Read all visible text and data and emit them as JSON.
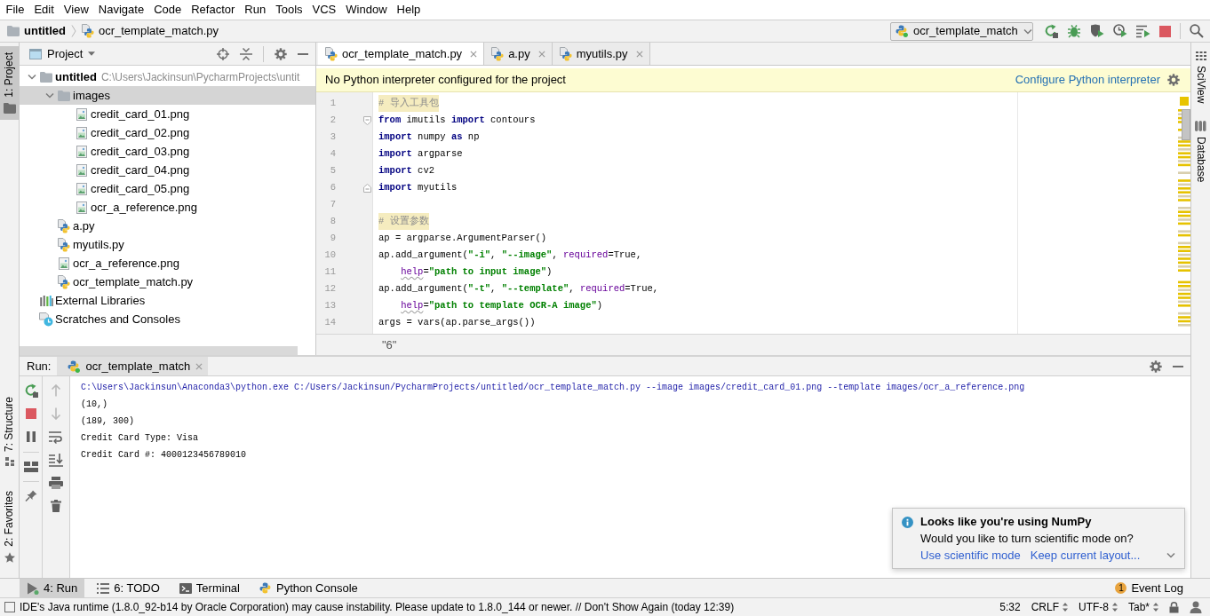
{
  "menu": [
    "File",
    "Edit",
    "View",
    "Navigate",
    "Code",
    "Refactor",
    "Run",
    "Tools",
    "VCS",
    "Window",
    "Help"
  ],
  "navigation_bar": {
    "breadcrumbs": [
      {
        "label": "untitled",
        "kind": "folder"
      },
      {
        "label": "ocr_template_match.py",
        "kind": "python"
      }
    ],
    "run_configuration": "ocr_template_match"
  },
  "left_stripe": [
    {
      "label": "1: Project",
      "kind": "project",
      "selected": true
    },
    {
      "label": "7: Structure",
      "kind": "structure",
      "selected": false
    },
    {
      "label": "2: Favorites",
      "kind": "favorites",
      "selected": false
    }
  ],
  "right_stripe": [
    {
      "label": "SciView",
      "kind": "sciview"
    },
    {
      "label": "Database",
      "kind": "database"
    }
  ],
  "project": {
    "title": "Project",
    "tree": [
      {
        "label": "untitled",
        "path": "C:\\Users\\Jackinsun\\PycharmProjects\\untit",
        "kind": "folder",
        "expanded": true,
        "selected": false,
        "children": [
          {
            "label": "images",
            "kind": "folder",
            "expanded": true,
            "selected": true,
            "children": [
              {
                "label": "credit_card_01.png",
                "kind": "image",
                "selected": false
              },
              {
                "label": "credit_card_02.png",
                "kind": "image",
                "selected": false
              },
              {
                "label": "credit_card_03.png",
                "kind": "image",
                "selected": false
              },
              {
                "label": "credit_card_04.png",
                "kind": "image",
                "selected": false
              },
              {
                "label": "credit_card_05.png",
                "kind": "image",
                "selected": false
              },
              {
                "label": "ocr_a_reference.png",
                "kind": "image",
                "selected": false
              }
            ]
          },
          {
            "label": "a.py",
            "kind": "python",
            "selected": false
          },
          {
            "label": "myutils.py",
            "kind": "python",
            "selected": false
          },
          {
            "label": "ocr_a_reference.png",
            "kind": "image",
            "selected": false
          },
          {
            "label": "ocr_template_match.py",
            "kind": "python",
            "selected": false
          }
        ]
      },
      {
        "label": "External Libraries",
        "kind": "libraries",
        "selected": false
      },
      {
        "label": "Scratches and Consoles",
        "kind": "scratches",
        "selected": false
      }
    ]
  },
  "editor": {
    "tabs": [
      {
        "label": "ocr_template_match.py",
        "selected": true
      },
      {
        "label": "a.py",
        "selected": false
      },
      {
        "label": "myutils.py",
        "selected": false
      }
    ],
    "banner": {
      "message": "No Python interpreter configured for the project",
      "action": "Configure Python interpreter"
    },
    "lines": [
      {
        "number": "1",
        "kind": "code",
        "tokens": [
          {
            "kind": "comment",
            "text": "# 导入工具包"
          }
        ]
      },
      {
        "number": "2",
        "kind": "fold_start",
        "tokens": [
          {
            "kind": "keyword",
            "text": "from"
          },
          {
            "kind": "plain",
            "text": " imutils "
          },
          {
            "kind": "keyword",
            "text": "import"
          },
          {
            "kind": "plain",
            "text": " contours"
          }
        ]
      },
      {
        "number": "3",
        "kind": "code",
        "tokens": [
          {
            "kind": "keyword",
            "text": "import"
          },
          {
            "kind": "plain",
            "text": " numpy "
          },
          {
            "kind": "keyword",
            "text": "as"
          },
          {
            "kind": "plain",
            "text": " np"
          }
        ]
      },
      {
        "number": "4",
        "kind": "code",
        "tokens": [
          {
            "kind": "keyword",
            "text": "import"
          },
          {
            "kind": "plain",
            "text": " argparse"
          }
        ]
      },
      {
        "number": "5",
        "kind": "code",
        "tokens": [
          {
            "kind": "keyword",
            "text": "import"
          },
          {
            "kind": "plain",
            "text": " cv2"
          }
        ]
      },
      {
        "number": "6",
        "kind": "fold_end",
        "tokens": [
          {
            "kind": "keyword",
            "text": "import"
          },
          {
            "kind": "plain",
            "text": " myutils"
          }
        ]
      },
      {
        "number": "7",
        "kind": "blank"
      },
      {
        "number": "8",
        "kind": "code",
        "tokens": [
          {
            "kind": "comment",
            "text": "# 设置参数"
          }
        ]
      },
      {
        "number": "9",
        "kind": "code",
        "tokens": [
          {
            "kind": "plain",
            "text": "ap = argparse.ArgumentParser()"
          }
        ]
      },
      {
        "number": "10",
        "kind": "code",
        "tokens": [
          {
            "kind": "plain",
            "text": "ap.add_argument("
          },
          {
            "kind": "string",
            "text": "\"-i\""
          },
          {
            "kind": "plain",
            "text": ", "
          },
          {
            "kind": "string",
            "text": "\"--image\""
          },
          {
            "kind": "plain",
            "text": ", "
          },
          {
            "kind": "param",
            "text": "required"
          },
          {
            "kind": "plain",
            "text": "=True,"
          }
        ]
      },
      {
        "number": "11",
        "kind": "code",
        "indented": true,
        "tokens": [
          {
            "kind": "param",
            "text": "help",
            "typo": true
          },
          {
            "kind": "plain",
            "text": "="
          },
          {
            "kind": "string",
            "text": "\"path to input image\""
          },
          {
            "kind": "plain",
            "text": ")"
          }
        ]
      },
      {
        "number": "12",
        "kind": "code",
        "tokens": [
          {
            "kind": "plain",
            "text": "ap.add_argument("
          },
          {
            "kind": "string",
            "text": "\"-t\""
          },
          {
            "kind": "plain",
            "text": ", "
          },
          {
            "kind": "string",
            "text": "\"--template\""
          },
          {
            "kind": "plain",
            "text": ", "
          },
          {
            "kind": "param",
            "text": "required"
          },
          {
            "kind": "plain",
            "text": "=True,"
          }
        ]
      },
      {
        "number": "13",
        "kind": "code",
        "indented": true,
        "tokens": [
          {
            "kind": "param",
            "text": "help",
            "typo": true
          },
          {
            "kind": "plain",
            "text": "="
          },
          {
            "kind": "string",
            "text": "\"path to template OCR-A image\""
          },
          {
            "kind": "plain",
            "text": ")"
          }
        ]
      },
      {
        "number": "14",
        "kind": "code",
        "tokens": [
          {
            "kind": "plain",
            "text": "args = vars(ap.parse_args())"
          }
        ]
      }
    ],
    "breadcrumb": "\"6\""
  },
  "run": {
    "title": "Run:",
    "tab": {
      "label": "ocr_template_match",
      "selected": true
    },
    "output": [
      {
        "kind": "command",
        "text": "C:\\Users\\Jackinsun\\Anaconda3\\python.exe C:/Users/Jackinsun/PycharmProjects/untitled/ocr_template_match.py --image images/credit_card_01.png --template images/ocr_a_reference.png"
      },
      {
        "kind": "output",
        "text": "(10,)"
      },
      {
        "kind": "output",
        "text": "(189, 300)"
      },
      {
        "kind": "output",
        "text": "Credit Card Type: Visa"
      },
      {
        "kind": "output",
        "text": "Credit Card #: 4000123456789010"
      }
    ]
  },
  "notification": {
    "title": "Looks like you're using NumPy",
    "message": "Would you like to turn scientific mode on?",
    "actions": [
      "Use scientific mode",
      "Keep current layout..."
    ]
  },
  "tool_windows": [
    {
      "label": "4: Run",
      "kind": "run",
      "selected": true
    },
    {
      "label": "6: TODO",
      "kind": "todo",
      "selected": false
    },
    {
      "label": "Terminal",
      "kind": "terminal",
      "selected": false
    },
    {
      "label": "Python Console",
      "kind": "python_console",
      "selected": false
    }
  ],
  "event_log": {
    "label": "Event Log",
    "count": "1"
  },
  "status_bar": {
    "message": "IDE's Java runtime (1.8.0_92-b14 by Oracle Corporation) may cause instability. Please update to 1.8.0_144 or newer. // Don't Show Again (today 12:39)",
    "items": [
      {
        "label": "5:32",
        "kind": "position"
      },
      {
        "label": "CRLF",
        "kind": "line_separator"
      },
      {
        "label": "UTF-8",
        "kind": "encoding"
      },
      {
        "label": "Tab*",
        "kind": "indent"
      }
    ]
  }
}
